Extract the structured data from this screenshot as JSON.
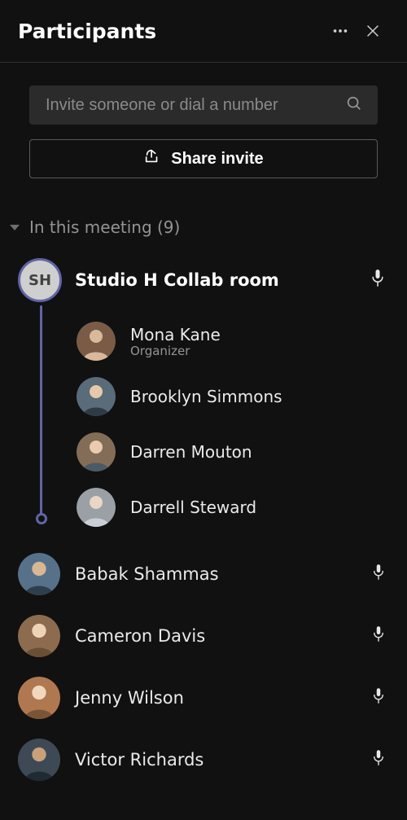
{
  "header": {
    "title": "Participants"
  },
  "search": {
    "placeholder": "Invite someone or dial a number"
  },
  "share_button": {
    "label": "Share invite"
  },
  "section": {
    "label": "In this meeting (9)"
  },
  "room": {
    "initials": "SH",
    "name": "Studio H Collab room",
    "children": [
      {
        "name": "Mona Kane",
        "role": "Organizer"
      },
      {
        "name": "Brooklyn Simmons"
      },
      {
        "name": "Darren Mouton"
      },
      {
        "name": "Darrell Steward"
      }
    ]
  },
  "participants": [
    {
      "name": "Babak Shammas",
      "mic": true
    },
    {
      "name": "Cameron Davis",
      "mic": true
    },
    {
      "name": "Jenny Wilson",
      "mic": true
    },
    {
      "name": "Victor Richards",
      "mic": true
    }
  ]
}
